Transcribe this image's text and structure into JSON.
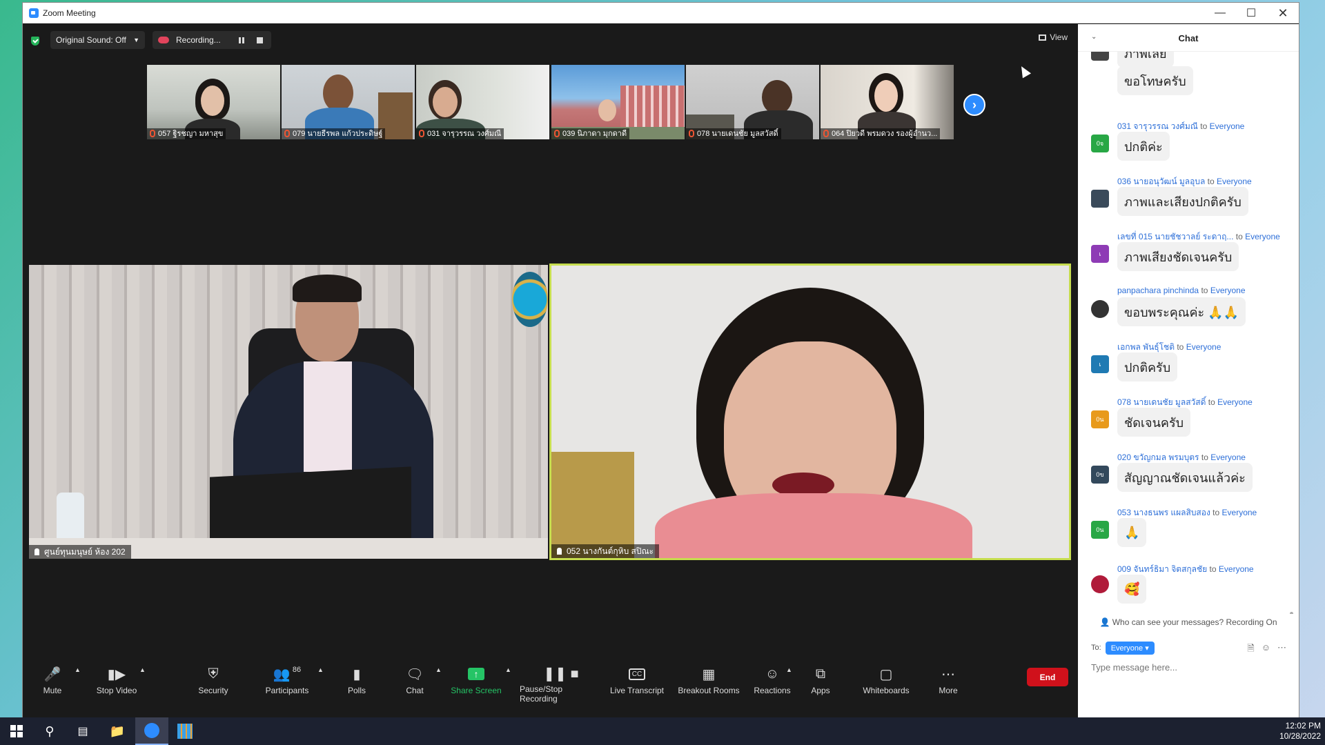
{
  "window": {
    "title": "Zoom Meeting"
  },
  "topbar": {
    "original_sound": "Original Sound: Off",
    "recording": "Recording...",
    "view": "View"
  },
  "thumbnails": [
    {
      "name": "057 ฐิรชญา มหาสุข"
    },
    {
      "name": "079 นายธีรพล แก้วประดิษฐ์"
    },
    {
      "name": "031 จารุวรรณ  วงศ์มณี"
    },
    {
      "name": "039 นิภาดา มุกดาดี"
    },
    {
      "name": "078 นายเดนชัย  มูลสวัสดิ์"
    },
    {
      "name": "064 ปิยวดี  พรมดวง รองผู้อำนว..."
    }
  ],
  "main_videos": [
    {
      "name": "ศูนย์ทุนมนุษย์ ห้อง 202"
    },
    {
      "name": "052 นางกันต์กุหิบ  สปิณะ"
    }
  ],
  "toolbar": {
    "mute": "Mute",
    "stop_video": "Stop Video",
    "security": "Security",
    "participants": "Participants",
    "participant_count": "86",
    "polls": "Polls",
    "chat": "Chat",
    "share_screen": "Share Screen",
    "pause_stop_recording": "Pause/Stop Recording",
    "live_transcript": "Live Transcript",
    "breakout_rooms": "Breakout Rooms",
    "reactions": "Reactions",
    "apps": "Apps",
    "whiteboards": "Whiteboards",
    "more": "More",
    "end": "End"
  },
  "chat": {
    "title": "Chat",
    "messages": [
      {
        "sender": "",
        "to": "",
        "text": "ภาพเลย",
        "avatar": "",
        "color": "#444444"
      },
      {
        "sender": "",
        "to": "",
        "text": "ขอโทษครับ",
        "avatar": "",
        "color": "#444444"
      },
      {
        "sender": "031 จารุวรรณ  วงศ์มณี",
        "to": "Everyone",
        "text": "ปกติค่ะ",
        "avatar": "0จ",
        "color": "#28a745"
      },
      {
        "sender": "036 นายอนุวัฒน์ มูลอุบล",
        "to": "Everyone",
        "text": "ภาพและเสียงปกติครับ",
        "avatar": "",
        "color": "#3a4a5a"
      },
      {
        "sender": "เลขที่ 015 นายชัชวาลย์ ระดาฤ...",
        "to": "Everyone",
        "text": "ภาพเสียงชัดเจนครับ",
        "avatar": "เ",
        "color": "#8e3bb5"
      },
      {
        "sender": "panpachara pinchinda",
        "to": "Everyone",
        "text": "ขอบพระคุณค่ะ 🙏🙏",
        "avatar": "",
        "color": "#333333"
      },
      {
        "sender": "เอกพล พันธุ์โชติ",
        "to": "Everyone",
        "text": "ปกติครับ",
        "avatar": "เ",
        "color": "#1f7ab3"
      },
      {
        "sender": "078 นายเดนชัย  มูลสวัสดิ์",
        "to": "Everyone",
        "text": "ชัดเจนครับ",
        "avatar": "0น",
        "color": "#e89a1c"
      },
      {
        "sender": "020 ขวัญกมล พรมบุตร",
        "to": "Everyone",
        "text": "สัญญาณชัดเจนแล้วค่ะ",
        "avatar": "0ข",
        "color": "#33495c"
      },
      {
        "sender": "053 นางธนพร แผลสิบสอง",
        "to": "Everyone",
        "text": "🙏",
        "avatar": "0น",
        "color": "#28a745"
      },
      {
        "sender": "009 จันทร์ธิมา  จิตสกุลชัย",
        "to": "Everyone",
        "text": "🥰",
        "avatar": "",
        "color": "#b01b3a"
      }
    ],
    "who_can_see": "Who can see your messages? Recording On",
    "to_label": "To:",
    "to_value": "Everyone",
    "placeholder": "Type message here..."
  },
  "taskbar": {
    "time": "12:02 PM",
    "date": "10/28/2022"
  }
}
